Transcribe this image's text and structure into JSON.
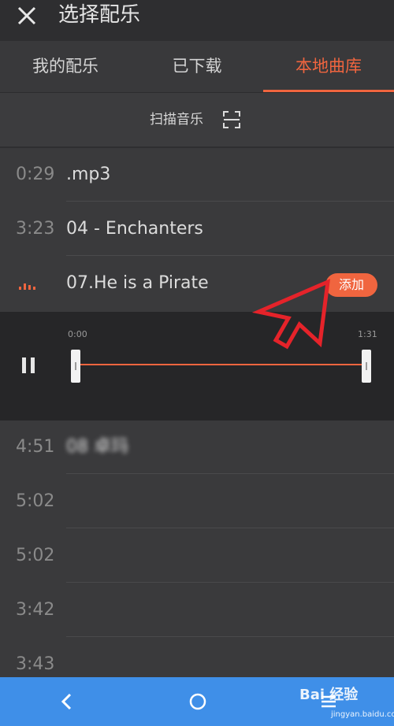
{
  "header": {
    "title": "选择配乐"
  },
  "tabs": [
    {
      "label": "我的配乐",
      "active": false
    },
    {
      "label": "已下载",
      "active": false
    },
    {
      "label": "本地曲库",
      "active": true
    }
  ],
  "scan": {
    "label": "扫描音乐"
  },
  "tracks": [
    {
      "duration": "0:29",
      "name": ".mp3"
    },
    {
      "duration": "3:23",
      "name": "04 - Enchanters"
    },
    {
      "duration": "",
      "name": "07.He is a Pirate",
      "playing": true,
      "action": "添加"
    },
    {
      "duration": "4:51",
      "name": "08 卓玛"
    },
    {
      "duration": "5:02",
      "name": ""
    },
    {
      "duration": "5:02",
      "name": ""
    },
    {
      "duration": "3:42",
      "name": ""
    },
    {
      "duration": "3:43",
      "name": ""
    }
  ],
  "player": {
    "time_start": "0:00",
    "time_end": "1:31",
    "progress": 0
  },
  "watermark": {
    "brand": "Bai  经验",
    "url": "jingyan.baidu.com"
  },
  "colors": {
    "accent": "#f0653f",
    "nav": "#3f8fe8"
  }
}
